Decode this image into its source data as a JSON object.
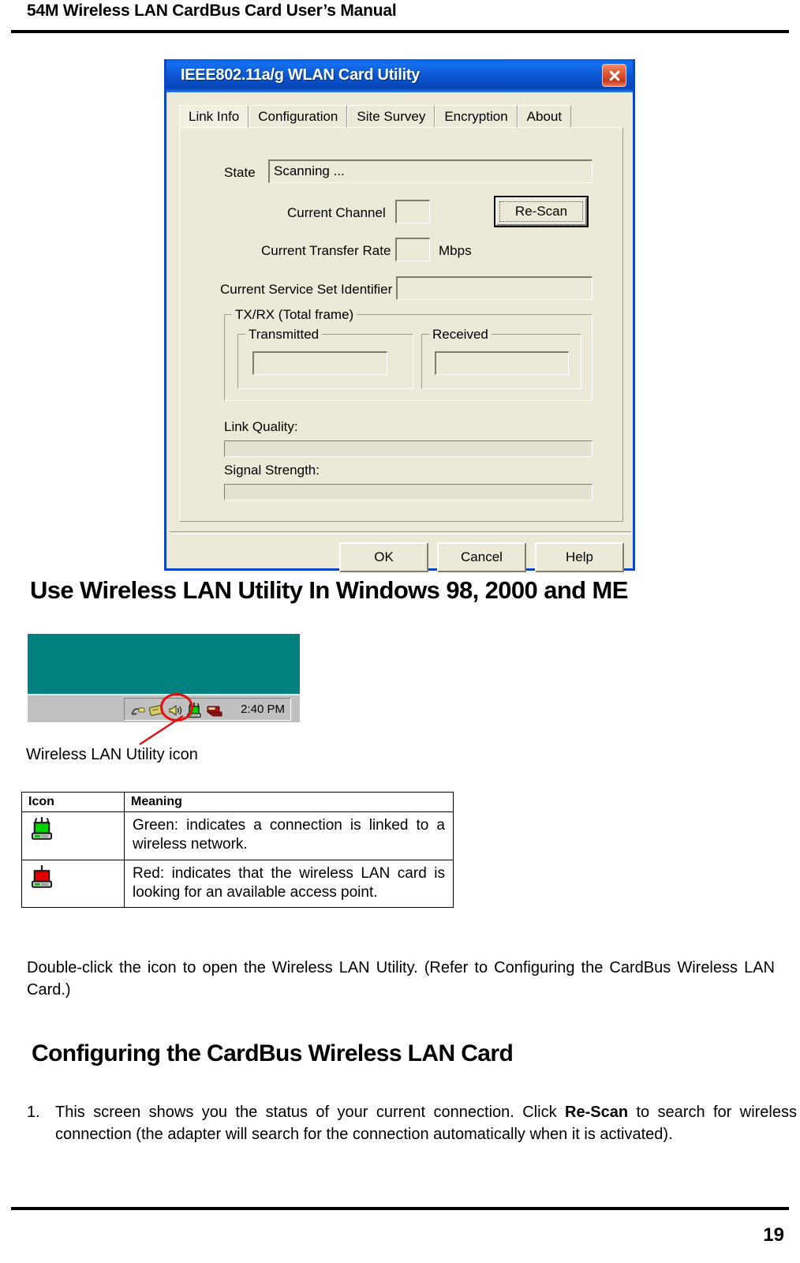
{
  "header": {
    "title": "54M Wireless LAN CardBus Card User’s Manual"
  },
  "dialog": {
    "title": "IEEE802.11a/g WLAN Card Utility",
    "close_icon": "close-icon",
    "tabs": [
      {
        "label": "Link Info",
        "active": true
      },
      {
        "label": "Configuration",
        "active": false
      },
      {
        "label": "Site Survey",
        "active": false
      },
      {
        "label": "Encryption",
        "active": false
      },
      {
        "label": "About",
        "active": false
      }
    ],
    "link_info": {
      "state_label": "State",
      "state_value": "Scanning ...",
      "current_channel_label": "Current Channel",
      "current_channel_value": "",
      "current_transfer_rate_label": "Current Transfer Rate",
      "current_transfer_rate_value": "",
      "mbps_unit": "Mbps",
      "ssid_label": "Current Service Set Identifier",
      "ssid_value": "",
      "rescan_button": "Re-Scan",
      "txrx_group_title": "TX/RX (Total frame)",
      "transmitted_group_title": "Transmitted",
      "transmitted_value": "",
      "received_group_title": "Received",
      "received_value": "",
      "link_quality_label": "Link Quality:",
      "link_quality_percent": 0,
      "signal_strength_label": "Signal Strength:",
      "signal_strength_percent": 0
    },
    "buttons": {
      "ok": "OK",
      "cancel": "Cancel",
      "help": "Help"
    }
  },
  "section_heading": "Use Wireless LAN Utility In Windows 98, 2000 and ME",
  "screenshot": {
    "desktop_color": "#018080",
    "taskbar_color": "#c0c0c0",
    "tray_time": "2:40 PM",
    "tray_icons": [
      "pcmcia-eject-icon",
      "card-icon",
      "volume-icon",
      "wireless-lan-utility-icon",
      "modem-icon"
    ],
    "highlight_color": "#e01010",
    "caption": "Wireless LAN Utility icon"
  },
  "icon_table": {
    "headers": [
      "Icon",
      "Meaning"
    ],
    "rows": [
      {
        "icon": "wireless-status-green-icon",
        "icon_color": "#00d200",
        "meaning": "Green: indicates a connection is linked to a wireless network."
      },
      {
        "icon": "wireless-status-red-icon",
        "icon_color": "#e00000",
        "meaning": "Red: indicates that the wireless LAN card is looking for an available access point."
      }
    ]
  },
  "paragraphs": {
    "double_click": "Double-click the icon to open the Wireless LAN Utility.  (Refer to  Configuring the CardBus Wireless LAN Card.)"
  },
  "configuring": {
    "heading": "Configuring the CardBus Wireless LAN Card",
    "step_number": "1.",
    "step_text_part1": "This screen shows you the status of your current connection. Click  ",
    "step_text_bold": "Re-Scan",
    "step_text_part2": " to search for wireless connection (the adapter will search for the connection automatically when it is activated)."
  },
  "footer": {
    "page_number": "19"
  }
}
